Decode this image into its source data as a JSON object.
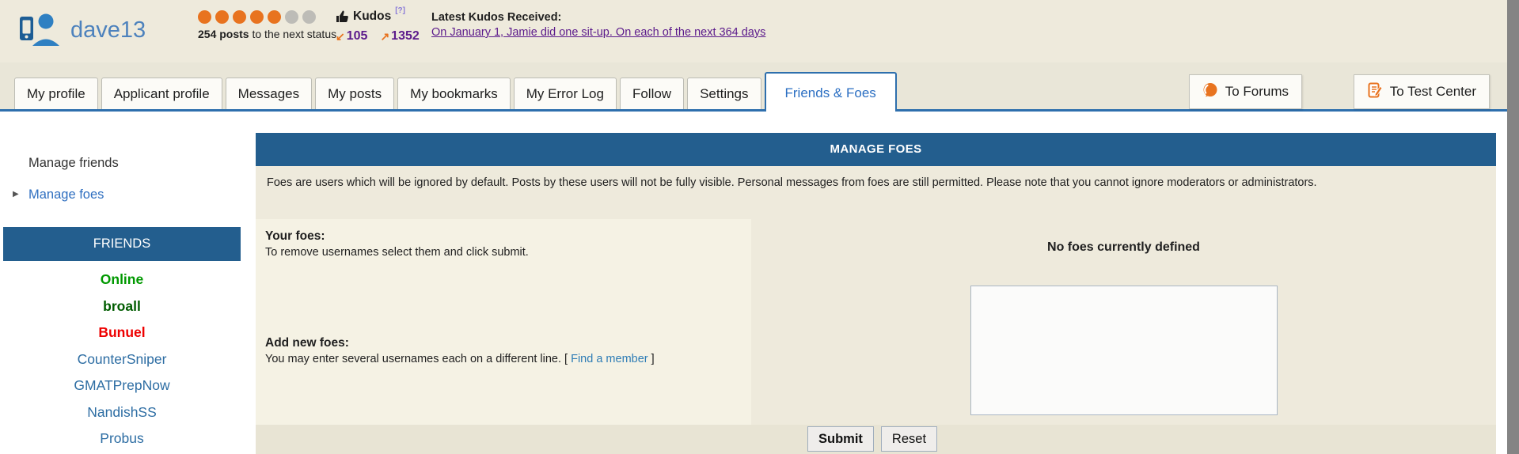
{
  "header": {
    "username": "dave13",
    "status": {
      "dots_filled": 5,
      "dots_total": 7,
      "dot_filled_color": "#e8731f",
      "dot_empty_color": "#bdbcb7",
      "posts_bold": "254 posts",
      "posts_rest": " to the next status"
    },
    "kudos": {
      "label": "Kudos",
      "help_badge": "[?]",
      "received_arrow": "↙",
      "received_count": "105",
      "given_arrow": "↗",
      "given_count": "1352",
      "latest_label": "Latest Kudos Received:",
      "latest_link": "On January 1, Jamie did one sit-up. On each of the next 364 days"
    }
  },
  "tab_bar": {
    "tabs": [
      {
        "label": "My profile",
        "active": false
      },
      {
        "label": "Applicant profile",
        "active": false
      },
      {
        "label": "Messages",
        "active": false
      },
      {
        "label": "My posts",
        "active": false
      },
      {
        "label": "My bookmarks",
        "active": false
      },
      {
        "label": "My Error Log",
        "active": false
      },
      {
        "label": "Follow",
        "active": false
      },
      {
        "label": "Settings",
        "active": false
      },
      {
        "label": "Friends & Foes",
        "active": true
      }
    ],
    "actions": [
      {
        "label": "To Forums",
        "icon": "forum-icon"
      },
      {
        "label": "To Test Center",
        "icon": "test-center-icon"
      }
    ]
  },
  "sidebar": {
    "links": [
      {
        "label": "Manage friends",
        "selected": false
      },
      {
        "label": "Manage foes",
        "selected": true
      }
    ],
    "friends_title": "FRIENDS",
    "friends": [
      {
        "name": "Online",
        "color": "#009900",
        "bold": true
      },
      {
        "name": "broall",
        "color": "#005c00",
        "bold": true
      },
      {
        "name": "Bunuel",
        "color": "#ee0000",
        "bold": true
      },
      {
        "name": "CounterSniper",
        "color": "#2d6da3",
        "bold": false
      },
      {
        "name": "GMATPrepNow",
        "color": "#2d6da3",
        "bold": false
      },
      {
        "name": "NandishSS",
        "color": "#2d6da3",
        "bold": false
      },
      {
        "name": "Probus",
        "color": "#2d6da3",
        "bold": false
      }
    ]
  },
  "main": {
    "title": "MANAGE FOES",
    "description": "Foes are users which will be ignored by default. Posts by these users will not be fully visible. Personal messages from foes are still permitted. Please note that you cannot ignore moderators or administrators.",
    "your_foes": {
      "label": "Your foes:",
      "hint": "To remove usernames select them and click submit.",
      "empty_message": "No foes currently defined"
    },
    "add_foes": {
      "label": "Add new foes:",
      "hint_before": "You may enter several usernames each on a different line. [ ",
      "find_member_link": "Find a member",
      "hint_after": " ]",
      "textarea_value": ""
    },
    "buttons": {
      "submit": "Submit",
      "reset": "Reset"
    }
  },
  "colors": {
    "bar_blue": "#235e8e",
    "accent_blue": "#2e6fad",
    "active_tab_blue": "#2a6ec2",
    "link_blue": "#2d6da3",
    "orange": "#e8731f",
    "kudos_purple": "#5b1a8b",
    "beige": "#eeeadc"
  }
}
